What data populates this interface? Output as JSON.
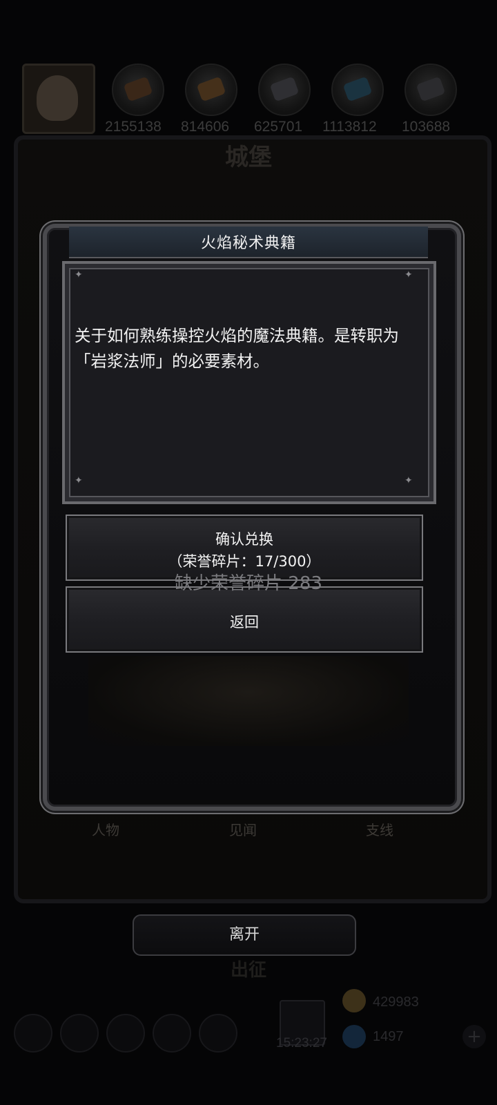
{
  "background": {
    "resources": [
      "2155138",
      "814606",
      "625701",
      "1113812",
      "103688"
    ],
    "castle_title": "城堡",
    "tabs": [
      "人物",
      "见闻",
      "支线"
    ],
    "depart_label": "出征",
    "currency_gold": "429983",
    "currency_gem": "1497",
    "clock": "15:23:27"
  },
  "modal": {
    "title": "火焰秘术典籍",
    "description": "关于如何熟练操控火焰的魔法典籍。是转职为「岩浆法师」的必要素材。",
    "confirm_label": "确认兑换",
    "confirm_cost": "（荣誉碎片：17/300）",
    "lack_text": "缺少荣誉碎片 283",
    "back_label": "返回"
  },
  "leave_label": "离开"
}
